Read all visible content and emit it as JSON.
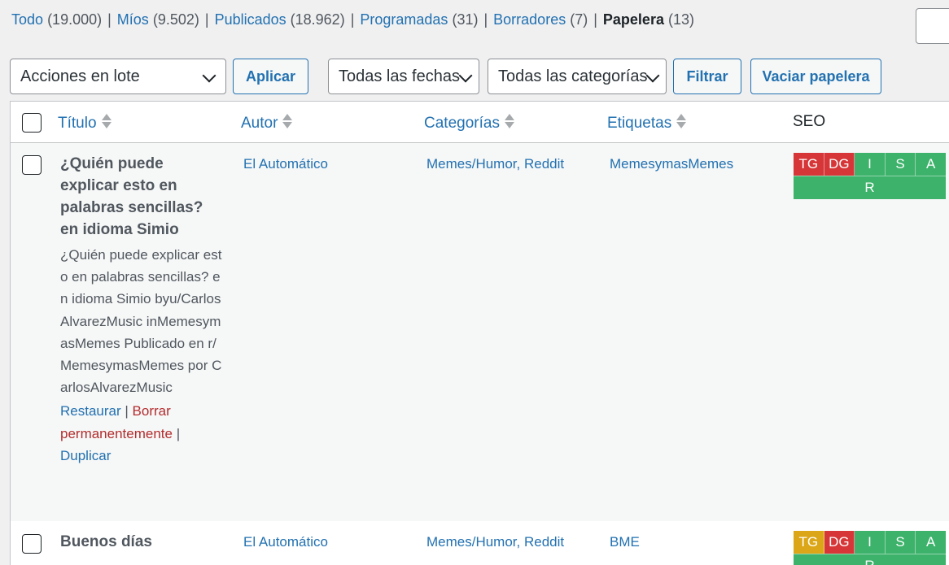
{
  "status_links": [
    {
      "label": "Todo",
      "count": "(19.000)"
    },
    {
      "label": "Míos",
      "count": "(9.502)"
    },
    {
      "label": "Publicados",
      "count": "(18.962)"
    },
    {
      "label": "Programadas",
      "count": "(31)"
    },
    {
      "label": "Borradores",
      "count": "(7)"
    },
    {
      "label": "Papelera",
      "count": "(13)"
    }
  ],
  "separator": "|",
  "tablenav": {
    "bulk_action": "Acciones en lote",
    "apply": "Aplicar",
    "date_filter": "Todas las fechas",
    "category_filter": "Todas las categorías",
    "filter": "Filtrar",
    "empty_trash": "Vaciar papelera"
  },
  "columns": {
    "title": "Título",
    "author": "Autor",
    "categories": "Categorías",
    "tags": "Etiquetas",
    "seo": "SEO"
  },
  "rows": [
    {
      "title": "¿Quién puede explicar esto en palabras sencillas? en idioma Simio",
      "excerpt": "¿Quién puede explicar esto en palabras sencillas? en idioma Simio byu/CarlosAlvarezMusic inMemesymasMemes Publicado en r/MemesymasMemes por CarlosAlvarezMusic",
      "actions": {
        "restore": "Restaurar",
        "delete": "Borrar permanentemente",
        "duplicate": "Duplicar"
      },
      "author": "El Automático",
      "categories": "Memes/Humor, Reddit",
      "tags": "MemesymasMemes",
      "seo": {
        "tg": "TG",
        "dg": "DG",
        "i": "I",
        "s": "S",
        "a": "A",
        "r": "R"
      }
    },
    {
      "title": "Buenos días",
      "author": "El Automático",
      "categories": "Memes/Humor, Reddit",
      "tags": "BME",
      "seo": {
        "tg": "TG",
        "dg": "DG",
        "i": "I",
        "s": "S",
        "a": "A",
        "r": "R"
      }
    }
  ],
  "colors": {
    "link": "#2271b1",
    "seo_red": "#d63638",
    "seo_yellow": "#dba617",
    "seo_green": "#3cb26a",
    "delete_link": "#b32d2e"
  }
}
